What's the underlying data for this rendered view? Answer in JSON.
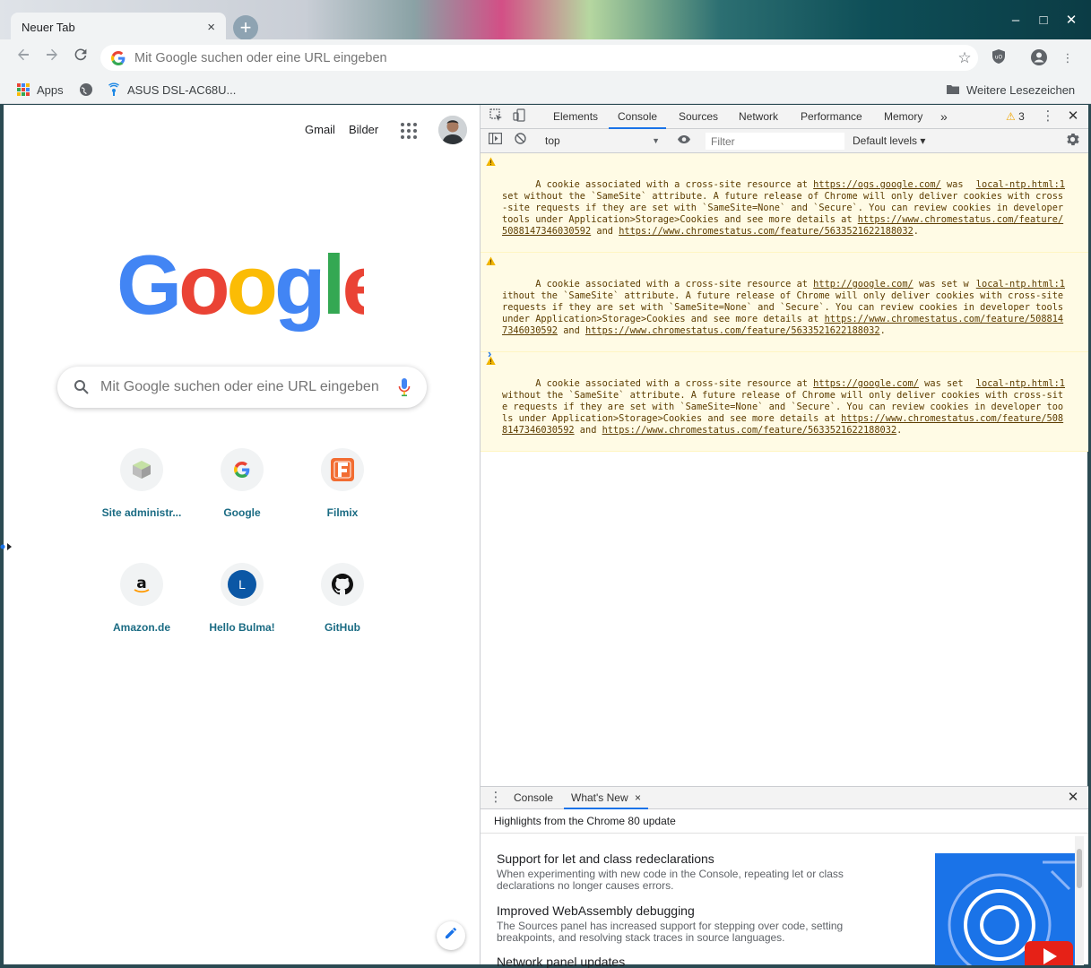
{
  "window": {
    "tab_title": "Neuer Tab",
    "tab_close": "×",
    "new_tab": "+",
    "minimize": "–",
    "maximize": "□",
    "close": "✕"
  },
  "toolbar": {
    "omnibox_placeholder": "Mit Google suchen oder eine URL eingeben",
    "icons": [
      "back-arrow-icon",
      "forward-arrow-icon",
      "reload-icon",
      "star-icon",
      "ublock-icon",
      "profile-icon",
      "menu-kebab-icon"
    ]
  },
  "bookmarks": {
    "apps_label": "Apps",
    "asus_label": "ASUS DSL-AC68U...",
    "other_label": "Weitere Lesezeichen"
  },
  "ntp": {
    "gmail": "Gmail",
    "images": "Bilder",
    "search_placeholder": "Mit Google suchen oder eine URL eingeben",
    "logo_text": "Google",
    "shortcuts": [
      {
        "label": "Site administr...",
        "icon": "cube-icon"
      },
      {
        "label": "Google",
        "icon": "google-g-icon"
      },
      {
        "label": "Filmix",
        "icon": "filmix-icon"
      },
      {
        "label": "Amazon.de",
        "icon": "amazon-icon"
      },
      {
        "label": "Hello Bulma!",
        "icon": "letter-l-icon",
        "letter": "L"
      },
      {
        "label": "GitHub",
        "icon": "github-icon"
      }
    ]
  },
  "devtools": {
    "tabs": [
      "Elements",
      "Console",
      "Sources",
      "Network",
      "Performance",
      "Memory"
    ],
    "active_tab": "Console",
    "more_tabs": "»",
    "warning_count": "3",
    "context": "top",
    "filter_placeholder": "Filter",
    "levels": "Default levels ▾",
    "messages": [
      {
        "source": "local-ntp.html:1",
        "p1": "A cookie associated with a cross-site resource at ",
        "url": "https://ogs.google.com/",
        "p2": " was set without the `SameSite` attribute. A future release of Chrome will only deliver cookies with cross-site requests if they are set with `SameSite=None` and `Secure`. You can review cookies in developer tools under Application>Storage>Cookies and see more details at ",
        "link1": "https://www.chromestatus.com/feature/5088147346030592",
        "p3": " and ",
        "link2": "https://www.chromestatus.com/feature/5633521622188032",
        "p4": "."
      },
      {
        "source": "local-ntp.html:1",
        "p1": "A cookie associated with a cross-site resource at ",
        "url": "http://google.com/",
        "p2": " was set without the `SameSite` attribute. A future release of Chrome will only deliver cookies with cross-site requests if they are set with `SameSite=None` and `Secure`. You can review cookies in developer tools under Application>Storage>Cookies and see more details at ",
        "link1": "https://www.chromestatus.com/feature/5088147346030592",
        "p3": " and ",
        "link2": "https://www.chromestatus.com/feature/5633521622188032",
        "p4": "."
      },
      {
        "source": "local-ntp.html:1",
        "p1": "A cookie associated with a cross-site resource at ",
        "url": "https://google.com/",
        "p2": " was set without the `SameSite` attribute. A future release of Chrome will only deliver cookies with cross-site requests if they are set with `SameSite=None` and `Secure`. You can review cookies in developer tools under Application>Storage>Cookies and see more details at ",
        "link1": "https://www.chromestatus.com/feature/5088147346030592",
        "p3": " and ",
        "link2": "https://www.chromestatus.com/feature/5633521622188032",
        "p4": "."
      }
    ],
    "prompt": "›",
    "drawer": {
      "tabs": [
        "Console",
        "What's New"
      ],
      "active_tab": "What's New",
      "tab_close": "×",
      "subtitle": "Highlights from the Chrome 80 update",
      "items": [
        {
          "title": "Support for let and class redeclarations",
          "text": "When experimenting with new code in the Console, repeating let or class declarations no longer causes errors."
        },
        {
          "title": "Improved WebAssembly debugging",
          "text": "The Sources panel has increased support for stepping over code, setting breakpoints, and resolving stack traces in source languages."
        },
        {
          "title": "Network panel updates",
          "text": ""
        }
      ]
    }
  },
  "colors": {
    "accent": "#1a73e8",
    "shortcut_label": "#1a6b83",
    "warning_bg": "#fffbe5",
    "warning_text": "#5c3c00"
  }
}
